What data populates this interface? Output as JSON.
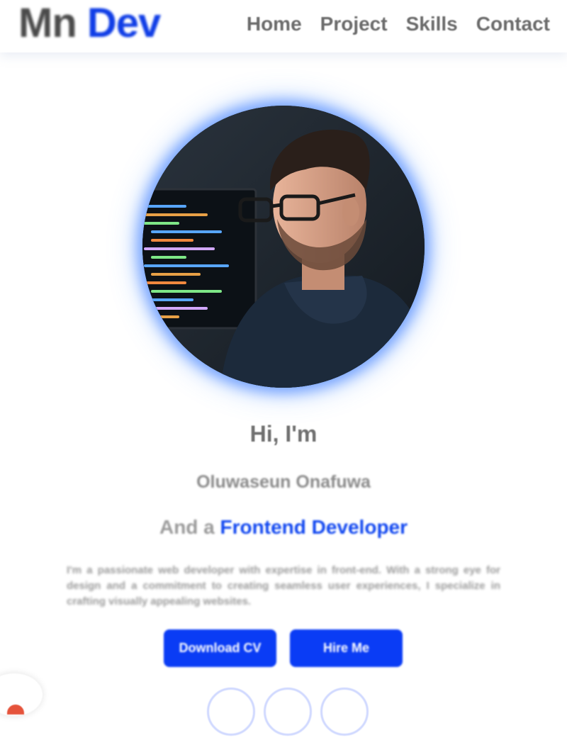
{
  "header": {
    "logo_part1": "Mn",
    "logo_part2": "Dev",
    "nav": [
      {
        "label": "Home"
      },
      {
        "label": "Project"
      },
      {
        "label": "Skills"
      },
      {
        "label": "Contact"
      }
    ]
  },
  "hero": {
    "avatar_image": "portrait-of-developer-at-computer",
    "greeting": "Hi, I'm",
    "name": "Oluwaseun Onafuwa",
    "role_prefix": "And a",
    "role_title": "Frontend Developer",
    "bio": "I'm a passionate web developer with expertise in front-end. With a strong eye for design and a commitment to creating seamless user experiences, I specialize in crafting visually appealing websites.",
    "buttons": [
      {
        "label": "Download CV"
      },
      {
        "label": "Hire Me"
      }
    ],
    "social_icons": [
      "social-icon-1",
      "social-icon-2",
      "social-icon-3"
    ]
  },
  "colors": {
    "accent": "#0a3cf5",
    "logo_dark": "#4a4a4a",
    "nav_text": "#6b6b6b",
    "glow": "#2a6eff"
  }
}
